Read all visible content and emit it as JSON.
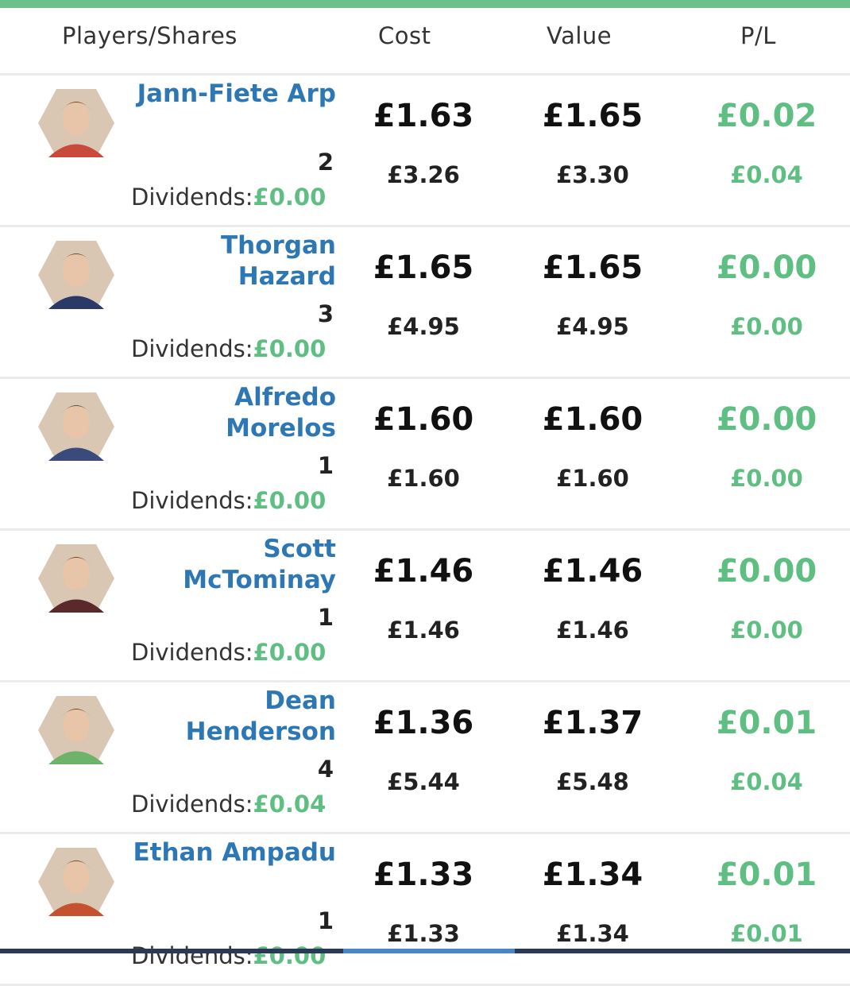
{
  "colors": {
    "accent_bar": "#6cc18a",
    "player_name": "#2e77b5",
    "profit": "#5fbf82"
  },
  "header": {
    "players": "Players/Shares",
    "cost": "Cost",
    "value": "Value",
    "pl": "P/L"
  },
  "dividends_label": "Dividends:",
  "rows": [
    {
      "name": "Jann-Fiete Arp",
      "shares": "2",
      "dividends": "£0.00",
      "cost_per": "£1.63",
      "cost_total": "£3.26",
      "value_per": "£1.65",
      "value_total": "£3.30",
      "pl_per": "£0.02",
      "pl_total": "£0.04",
      "avatar_color": "#c94a3a"
    },
    {
      "name": "Thorgan Hazard",
      "shares": "3",
      "dividends": "£0.00",
      "cost_per": "£1.65",
      "cost_total": "£4.95",
      "value_per": "£1.65",
      "value_total": "£4.95",
      "pl_per": "£0.00",
      "pl_total": "£0.00",
      "avatar_color": "#2a3a66"
    },
    {
      "name": "Alfredo Morelos",
      "shares": "1",
      "dividends": "£0.00",
      "cost_per": "£1.60",
      "cost_total": "£1.60",
      "value_per": "£1.60",
      "value_total": "£1.60",
      "pl_per": "£0.00",
      "pl_total": "£0.00",
      "avatar_color": "#3a4a7a"
    },
    {
      "name": "Scott McTominay",
      "shares": "1",
      "dividends": "£0.00",
      "cost_per": "£1.46",
      "cost_total": "£1.46",
      "value_per": "£1.46",
      "value_total": "£1.46",
      "pl_per": "£0.00",
      "pl_total": "£0.00",
      "avatar_color": "#5a2a2a"
    },
    {
      "name": "Dean Henderson",
      "shares": "4",
      "dividends": "£0.04",
      "cost_per": "£1.36",
      "cost_total": "£5.44",
      "value_per": "£1.37",
      "value_total": "£5.48",
      "pl_per": "£0.01",
      "pl_total": "£0.04",
      "avatar_color": "#6fb36a"
    },
    {
      "name": "Ethan Ampadu",
      "shares": "1",
      "dividends": "£0.00",
      "cost_per": "£1.33",
      "cost_total": "£1.33",
      "value_per": "£1.34",
      "value_total": "£1.34",
      "pl_per": "£0.01",
      "pl_total": "£0.01",
      "avatar_color": "#c4522e"
    }
  ]
}
